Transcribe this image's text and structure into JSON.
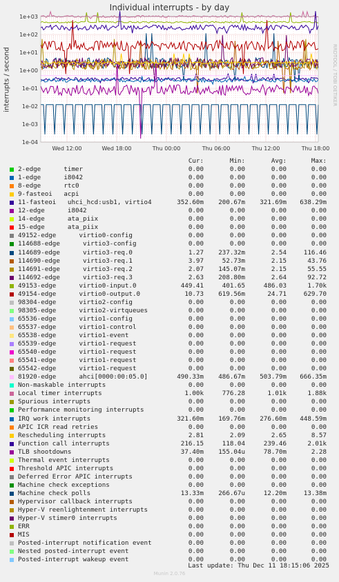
{
  "title": "Individual interrupts - by day",
  "side_label": "RRDTOOL / TOBI OETIKER",
  "footer": "Last update: Thu Dec 11 18:15:06 2025",
  "munin": "Munin 2.0.76",
  "columns": [
    "Cur:",
    "Min:",
    "Avg:",
    "Max:"
  ],
  "chart_data": {
    "type": "line",
    "title": "Individual interrupts - by day",
    "ylabel": "interrupts / second",
    "yscale": "log",
    "ylim": [
      0.0001,
      10000
    ],
    "y_ticks": [
      "1e+03",
      "1e+02",
      "1e+01",
      "1e+00",
      "1e-01",
      "1e-02",
      "1e-03",
      "1e-04"
    ],
    "x_ticks": [
      "Wed 12:00",
      "Wed 18:00",
      "Thu 00:00",
      "Thu 06:00",
      "Thu 12:00",
      "Thu 18:00"
    ],
    "grid": true,
    "series": [
      {
        "name": "2-edge      timer",
        "color": "#00cc00",
        "cur": "0.00",
        "min": "0.00",
        "avg": "0.00",
        "max": "0.00"
      },
      {
        "name": "1-edge      i8042",
        "color": "#0066b3",
        "cur": "0.00",
        "min": "0.00",
        "avg": "0.00",
        "max": "0.00"
      },
      {
        "name": "8-edge      rtc0",
        "color": "#ff8000",
        "cur": "0.00",
        "min": "0.00",
        "avg": "0.00",
        "max": "0.00"
      },
      {
        "name": "9-fasteoi   acpi",
        "color": "#ffcc00",
        "cur": "0.00",
        "min": "0.00",
        "avg": "0.00",
        "max": "0.00"
      },
      {
        "name": "11-fasteoi   uhci_hcd:usb1, virtio4",
        "color": "#330099",
        "cur": "352.60m",
        "min": "200.67m",
        "avg": "321.69m",
        "max": "638.29m"
      },
      {
        "name": "12-edge      i8042",
        "color": "#990099",
        "cur": "0.00",
        "min": "0.00",
        "avg": "0.00",
        "max": "0.00"
      },
      {
        "name": "14-edge      ata_piix",
        "color": "#ccff00",
        "cur": "0.00",
        "min": "0.00",
        "avg": "0.00",
        "max": "0.00"
      },
      {
        "name": "15-edge      ata_piix",
        "color": "#ff0000",
        "cur": "0.00",
        "min": "0.00",
        "avg": "0.00",
        "max": "0.00"
      },
      {
        "name": "49152-edge      virtio0-config",
        "color": "#808080",
        "cur": "0.00",
        "min": "0.00",
        "avg": "0.00",
        "max": "0.00"
      },
      {
        "name": "114688-edge      virtio3-config",
        "color": "#008f00",
        "cur": "0.00",
        "min": "0.00",
        "avg": "0.00",
        "max": "0.00"
      },
      {
        "name": "114689-edge      virtio3-req.0",
        "color": "#00487d",
        "cur": "1.27",
        "min": "237.32m",
        "avg": "2.54",
        "max": "116.46"
      },
      {
        "name": "114690-edge      virtio3-req.1",
        "color": "#b35a00",
        "cur": "3.97",
        "min": "52.73m",
        "avg": "2.15",
        "max": "43.76"
      },
      {
        "name": "114691-edge      virtio3-req.2",
        "color": "#b38f00",
        "cur": "2.07",
        "min": "145.07m",
        "avg": "2.15",
        "max": "55.55"
      },
      {
        "name": "114692-edge      virtio3-req.3",
        "color": "#6b006b",
        "cur": "2.63",
        "min": "208.80m",
        "avg": "2.64",
        "max": "92.72"
      },
      {
        "name": "49153-edge      virtio0-input.0",
        "color": "#8fb300",
        "cur": "449.41",
        "min": "401.65",
        "avg": "486.03",
        "max": "1.70k"
      },
      {
        "name": "49154-edge      virtio0-output.0",
        "color": "#b30000",
        "cur": "10.73",
        "min": "619.56m",
        "avg": "24.71",
        "max": "629.70"
      },
      {
        "name": "98304-edge      virtio2-config",
        "color": "#bebebe",
        "cur": "0.00",
        "min": "0.00",
        "avg": "0.00",
        "max": "0.00"
      },
      {
        "name": "98305-edge      virtio2-virtqueues",
        "color": "#80ff80",
        "cur": "0.00",
        "min": "0.00",
        "avg": "0.00",
        "max": "0.00"
      },
      {
        "name": "65536-edge      virtio1-config",
        "color": "#80c9ff",
        "cur": "0.00",
        "min": "0.00",
        "avg": "0.00",
        "max": "0.00"
      },
      {
        "name": "65537-edge      virtio1-control",
        "color": "#ffc080",
        "cur": "0.00",
        "min": "0.00",
        "avg": "0.00",
        "max": "0.00"
      },
      {
        "name": "65538-edge      virtio1-event",
        "color": "#ffe680",
        "cur": "0.00",
        "min": "0.00",
        "avg": "0.00",
        "max": "0.00"
      },
      {
        "name": "65539-edge      virtio1-request",
        "color": "#aa80ff",
        "cur": "0.00",
        "min": "0.00",
        "avg": "0.00",
        "max": "0.00"
      },
      {
        "name": "65540-edge      virtio1-request",
        "color": "#ee00cc",
        "cur": "0.00",
        "min": "0.00",
        "avg": "0.00",
        "max": "0.00"
      },
      {
        "name": "65541-edge      virtio1-request",
        "color": "#ff8080",
        "cur": "0.00",
        "min": "0.00",
        "avg": "0.00",
        "max": "0.00"
      },
      {
        "name": "65542-edge      virtio1-request",
        "color": "#666600",
        "cur": "0.00",
        "min": "0.00",
        "avg": "0.00",
        "max": "0.00"
      },
      {
        "name": "81920-edge      ahci[0000:00:05.0]",
        "color": "#ffbfff",
        "cur": "490.33m",
        "min": "486.67m",
        "avg": "503.79m",
        "max": "666.35m"
      },
      {
        "name": "Non-maskable interrupts",
        "color": "#00ffcc",
        "cur": "0.00",
        "min": "0.00",
        "avg": "0.00",
        "max": "0.00"
      },
      {
        "name": "Local timer interrupts",
        "color": "#cc6699",
        "cur": "1.00k",
        "min": "776.28",
        "avg": "1.01k",
        "max": "1.88k"
      },
      {
        "name": "Spurious interrupts",
        "color": "#999900",
        "cur": "0.00",
        "min": "0.00",
        "avg": "0.00",
        "max": "0.00"
      },
      {
        "name": "Performance monitoring interrupts",
        "color": "#00cc00",
        "cur": "0.00",
        "min": "0.00",
        "avg": "0.00",
        "max": "0.00"
      },
      {
        "name": "IRQ work interrupts",
        "color": "#0066b3",
        "cur": "321.60m",
        "min": "169.76m",
        "avg": "276.60m",
        "max": "448.59m"
      },
      {
        "name": "APIC ICR read retries",
        "color": "#ff8000",
        "cur": "0.00",
        "min": "0.00",
        "avg": "0.00",
        "max": "0.00"
      },
      {
        "name": "Rescheduling interrupts",
        "color": "#ffcc00",
        "cur": "2.81",
        "min": "2.09",
        "avg": "2.65",
        "max": "8.57"
      },
      {
        "name": "Function call interrupts",
        "color": "#330099",
        "cur": "216.15",
        "min": "118.04",
        "avg": "239.46",
        "max": "2.01k"
      },
      {
        "name": "TLB shootdowns",
        "color": "#990099",
        "cur": "37.40m",
        "min": "155.04u",
        "avg": "78.70m",
        "max": "2.28"
      },
      {
        "name": "Thermal event interrupts",
        "color": "#ccff00",
        "cur": "0.00",
        "min": "0.00",
        "avg": "0.00",
        "max": "0.00"
      },
      {
        "name": "Threshold APIC interrupts",
        "color": "#ff0000",
        "cur": "0.00",
        "min": "0.00",
        "avg": "0.00",
        "max": "0.00"
      },
      {
        "name": "Deferred Error APIC interrupts",
        "color": "#808080",
        "cur": "0.00",
        "min": "0.00",
        "avg": "0.00",
        "max": "0.00"
      },
      {
        "name": "Machine check exceptions",
        "color": "#008f00",
        "cur": "0.00",
        "min": "0.00",
        "avg": "0.00",
        "max": "0.00"
      },
      {
        "name": "Machine check polls",
        "color": "#00487d",
        "cur": "13.33m",
        "min": "266.67u",
        "avg": "12.20m",
        "max": "13.38m"
      },
      {
        "name": "Hypervisor callback interrupts",
        "color": "#b35a00",
        "cur": "0.00",
        "min": "0.00",
        "avg": "0.00",
        "max": "0.00"
      },
      {
        "name": "Hyper-V reenlightenment interrupts",
        "color": "#b38f00",
        "cur": "0.00",
        "min": "0.00",
        "avg": "0.00",
        "max": "0.00"
      },
      {
        "name": "Hyper-V stimer0 interrupts",
        "color": "#6b006b",
        "cur": "0.00",
        "min": "0.00",
        "avg": "0.00",
        "max": "0.00"
      },
      {
        "name": "ERR",
        "color": "#8fb300",
        "cur": "0.00",
        "min": "0.00",
        "avg": "0.00",
        "max": "0.00"
      },
      {
        "name": "MIS",
        "color": "#b30000",
        "cur": "0.00",
        "min": "0.00",
        "avg": "0.00",
        "max": "0.00"
      },
      {
        "name": "Posted-interrupt notification event",
        "color": "#bebebe",
        "cur": "0.00",
        "min": "0.00",
        "avg": "0.00",
        "max": "0.00"
      },
      {
        "name": "Nested posted-interrupt event",
        "color": "#80ff80",
        "cur": "0.00",
        "min": "0.00",
        "avg": "0.00",
        "max": "0.00"
      },
      {
        "name": "Posted-interrupt wakeup event",
        "color": "#80c9ff",
        "cur": "0.00",
        "min": "0.00",
        "avg": "0.00",
        "max": "0.00"
      }
    ]
  }
}
